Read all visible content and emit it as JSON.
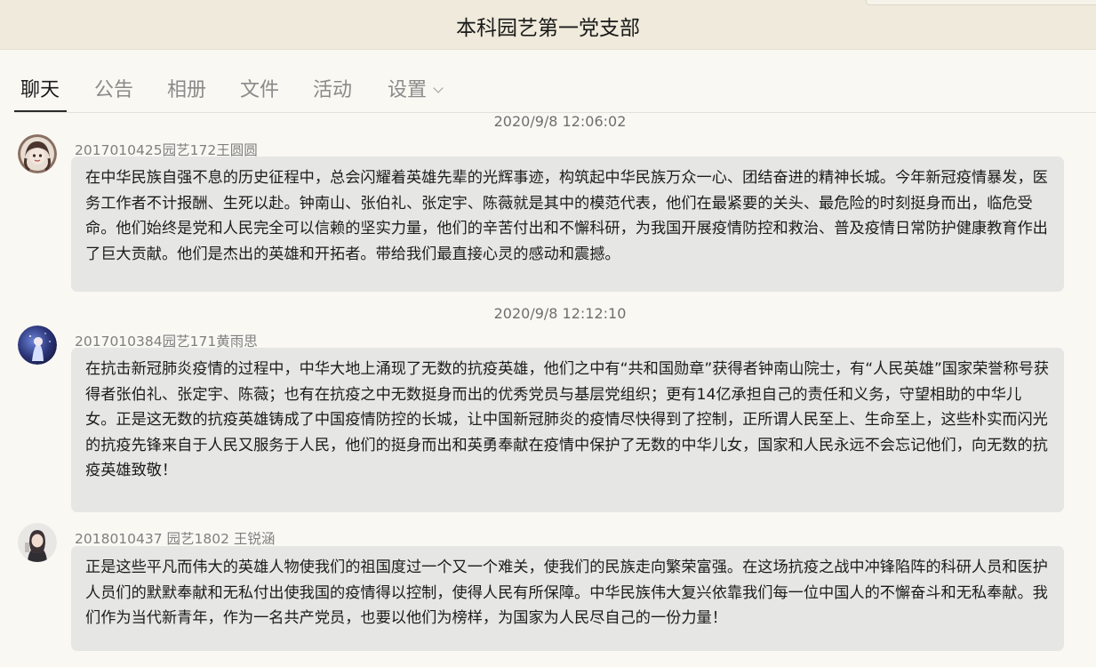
{
  "window": {
    "title": "本科园艺第一党支部"
  },
  "tabs": [
    {
      "label": "聊天"
    },
    {
      "label": "公告"
    },
    {
      "label": "相册"
    },
    {
      "label": "文件"
    },
    {
      "label": "活动"
    },
    {
      "label": "设置"
    }
  ],
  "messages": [
    {
      "timestamp": "2020/9/8 12:06:02",
      "sender": "2017010425园艺172王圆圆",
      "avatar_icon": "user-avatar-cartoon-girl",
      "text": "在中华民族自强不息的历史征程中，总会闪耀着英雄先辈的光辉事迹，构筑起中华民族万众一心、团结奋进的精神长城。今年新冠疫情暴发，医务工作者不计报酬、生死以赴。钟南山、张伯礼、张定宇、陈薇就是其中的模范代表，他们在最紧要的关头、最危险的时刻挺身而出，临危受命。他们始终是党和人民完全可以信赖的坚实力量，他们的辛苦付出和不懈科研，为我国开展疫情防控和救治、普及疫情日常防护健康教育作出了巨大贡献。他们是杰出的英雄和开拓者。带给我们最直接心灵的感动和震撼。"
    },
    {
      "timestamp": "2020/9/8 12:12:10",
      "sender": "2017010384园艺171黄雨思",
      "avatar_icon": "user-avatar-anime-night",
      "text": "在抗击新冠肺炎疫情的过程中，中华大地上涌现了无数的抗疫英雄，他们之中有“共和国勋章”获得者钟南山院士，有“人民英雄”国家荣誉称号获得者张伯礼、张定宇、陈薇；也有在抗疫之中无数挺身而出的优秀党员与基层党组织；更有14亿承担自己的责任和义务，守望相助的中华儿女。正是这无数的抗疫英雄铸成了中国疫情防控的长城，让中国新冠肺炎的疫情尽快得到了控制，正所谓人民至上、生命至上，这些朴实而闪光的抗疫先锋来自于人民又服务于人民，他们的挺身而出和英勇奉献在疫情中保护了无数的中华儿女，国家和人民永远不会忘记他们，向无数的抗疫英雄致敬！"
    },
    {
      "sender": "2018010437 园艺1802 王锐涵",
      "avatar_icon": "user-avatar-photo",
      "text": "正是这些平凡而伟大的英雄人物使我们的祖国度过一个又一个难关，使我们的民族走向繁荣富强。在这场抗疫之战中冲锋陷阵的科研人员和医护人员们的默默奉献和无私付出使我国的疫情得以控制，使得人民有所保障。中华民族伟大复兴依靠我们每一位中国人的不懈奋斗和无私奉献。我们作为当代新青年，作为一名共产党员，也要以他们为榜样，为国家为人民尽自己的一份力量！"
    }
  ]
}
